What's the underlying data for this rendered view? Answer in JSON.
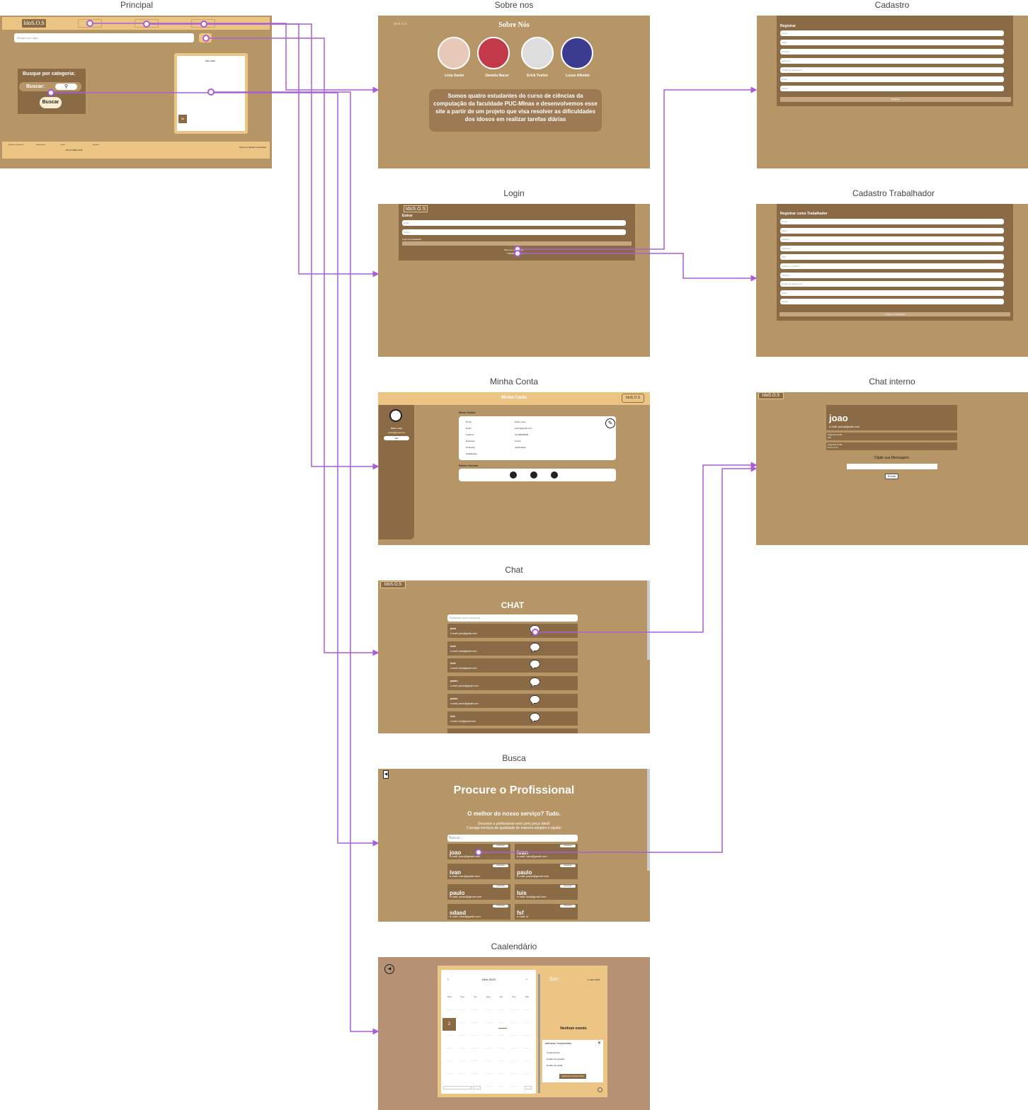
{
  "titles": {
    "principal": "Principal",
    "sobre": "Sobre nos",
    "cadastro": "Cadastro",
    "login": "Login",
    "cad_trab": "Cadastro Trabalhador",
    "minha_conta": "Minha Conta",
    "chat_interno": "Chat interno",
    "chat": "Chat",
    "busca": "Busca",
    "calendario": "Caalendário"
  },
  "colors": {
    "frame_bg": "#b69566",
    "dark_panel": "#8b6b45",
    "header_bar": "#ecc585",
    "link_line": "#a95ed6"
  },
  "principal": {
    "logo": "IdoS.O.S",
    "search_placeholder": "Busque por algo...",
    "category_title": "Busque por categoria:",
    "buscar_label": "Buscar:",
    "buscar_button": "Buscar",
    "calendar_month": "Maio 2023",
    "calendar_day": "28",
    "footer_col1": "Métodos de Pagamento",
    "footer_col2": "Redes Sociais",
    "footer_col3": "Contato",
    "footer_col4": "Newsletter",
    "footer_phone": "+55 31 9999-1234",
    "footer_rights": "Todos os direitos reservados"
  },
  "sobre": {
    "logo": "IdoS.O.S",
    "heading": "Sobre Nós",
    "members": [
      "Livia Xavier",
      "Daniela Nacur",
      "Erick Toshio",
      "Lucas Alkmim"
    ],
    "text": "Somos quatro estudantes do curso de ciências da computação da faculdade PUC-MInas e desenvolvemos esse site a partir de um projeto que visa resolver as dificuldades dos idosos em realizar tarefas diárias"
  },
  "cadastro": {
    "title": "Registrar",
    "fields": [
      "Nome",
      "Idade",
      "Telefone",
      "Endereço",
      "Cartão de Pagamento",
      "Email",
      "Senha"
    ],
    "button": "Registrar"
  },
  "login": {
    "logo": "IdoS.O.S",
    "title": "Entrar",
    "fields": [
      "Email",
      "Senha"
    ],
    "remember": "Login de trabalhador",
    "link1": "Não tem uma conta?",
    "link2": "Trabalhe conosco"
  },
  "cad_trab": {
    "title": "Registrar como Trabalhador",
    "fields": [
      "Nome",
      "Idade",
      "Telefone",
      "Endereço",
      "CPF",
      "Cidade de trabalho",
      "Serviços",
      "Cartão de Pagamento",
      "Email",
      "Senha"
    ],
    "button": "Registrar Trabalhador"
  },
  "minha_conta": {
    "header": "Minha Conta",
    "logo": "IdoS.O.S",
    "user_name": "Pedro Joao",
    "user_email": "pedro@gmail.com",
    "logout": "Sair",
    "data_title": "Meus Dados",
    "rows": [
      {
        "k": "Nome",
        "v": "Pedro Joao"
      },
      {
        "k": "Email",
        "v": "pedro@gmail.com"
      },
      {
        "k": "Telefone",
        "v": "31 999999999"
      },
      {
        "k": "Endereço",
        "v": "Centro"
      },
      {
        "k": "Profissão",
        "v": "Jardinidade"
      },
      {
        "k": "Habilidades",
        "v": ""
      }
    ],
    "social_title": "Redes Sociais"
  },
  "chat_interno": {
    "logo": "IdoS.O.S",
    "name": "joao",
    "email": "e-mail: joao@gmail.com",
    "msgs": [
      "Segunda 14:00\nOlá",
      "Segunda 14:05\nEu irei ir lá"
    ],
    "prompt": "Digite sua Mensagem:",
    "send": "Enviar"
  },
  "chat": {
    "logo": "IdoS.O.S",
    "heading": "CHAT",
    "search_placeholder": "Pesquisar uma conversa",
    "items": [
      {
        "name": "joao",
        "email": "e-mail: joao@gmail.com"
      },
      {
        "name": "ivan",
        "email": "e-mail: ivan@gmail.com"
      },
      {
        "name": "ivan",
        "email": "e-mail: ivan@gmail.com"
      },
      {
        "name": "paulo",
        "email": "e-mail: paulo@gmail.com"
      },
      {
        "name": "paulo",
        "email": "e-mail: paulo@gmail.com"
      },
      {
        "name": "luis",
        "email": "e-mail: luis@gmail.com"
      }
    ]
  },
  "busca": {
    "heading": "Procure o Profissional",
    "subheading": "O melhor do nosso serviço? Tudo.",
    "desc1": "Encontre o profissional certo pelo preço ideal!",
    "desc2": "Consiga serviços de qualidade de maneira simples e rápida!",
    "search_placeholder": "Buscar...",
    "cards": [
      {
        "name": "joao",
        "email": "e-mail: joao@gmail.com"
      },
      {
        "name": "ivan",
        "email": "e-mail: ivan@gmail.com"
      },
      {
        "name": "ivan",
        "email": "e-mail: ivan@gmail.com"
      },
      {
        "name": "paulo",
        "email": "e-mail: paulo@gmail.com"
      },
      {
        "name": "paulo",
        "email": "e-mail: paulo@gmail.com"
      },
      {
        "name": "luis",
        "email": "e-mail: luis@gmail.com"
      },
      {
        "name": "sdasd",
        "email": "e-mail: sdas@gmail.com"
      },
      {
        "name": "fsf",
        "email": "e-mail: sf"
      }
    ],
    "card_button": "Conversar"
  },
  "calendario": {
    "month": "Julho 2023",
    "weekdays": [
      "Dom",
      "Seg",
      "Ter",
      "Qua",
      "Qui",
      "Sex",
      "Sáb"
    ],
    "selected_day": "2",
    "day_label": "Sun",
    "date_label": "2 Julho 2023",
    "no_event": "Nenhum evento",
    "popup_title": "Adicionar Compromisso",
    "popup_fields": [
      "Compromisso",
      "Horário de entrada",
      "Horário de saída"
    ],
    "popup_button": "Adicionar Compromisso"
  }
}
